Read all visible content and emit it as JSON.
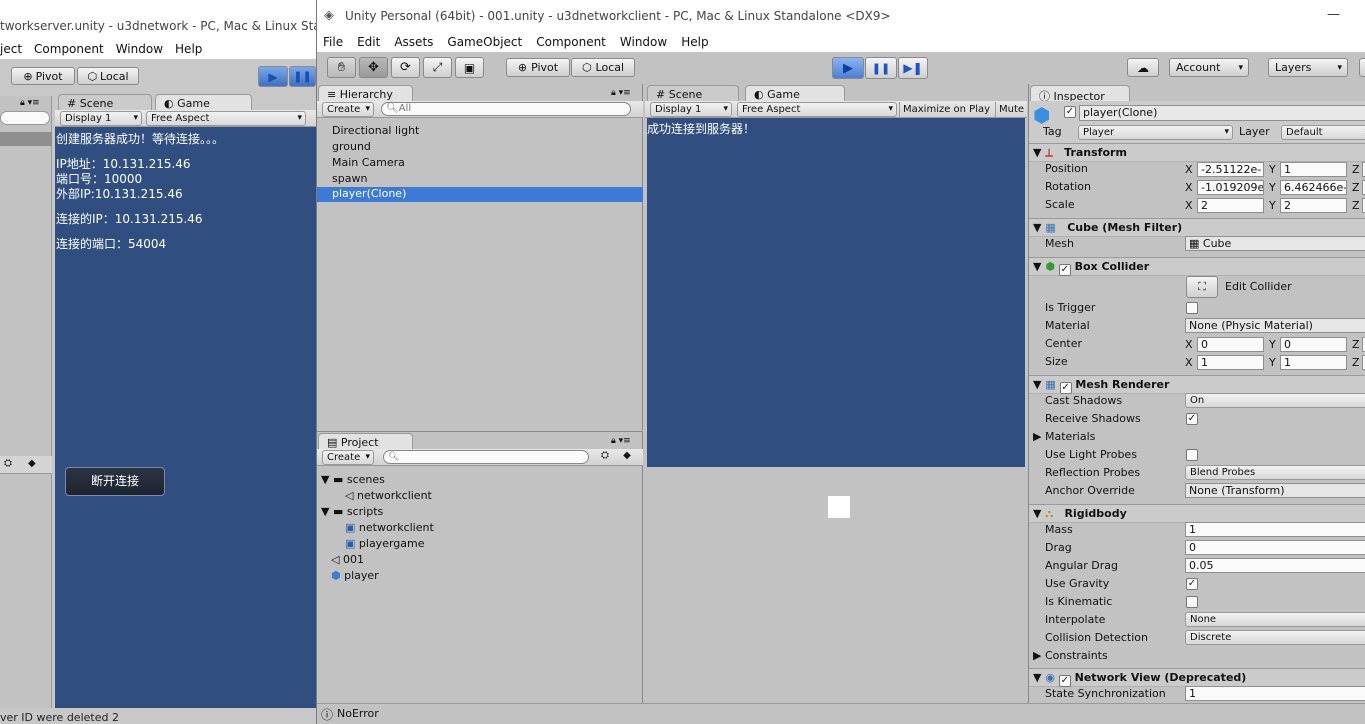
{
  "server": {
    "title": "tworkserver.unity - u3dnetwork - PC, Mac & Linux Sta",
    "menu": [
      "ject",
      "Component",
      "Window",
      "Help"
    ],
    "pivot": "Pivot",
    "local": "Local",
    "scene_tab": "Scene",
    "game_tab": "Game",
    "display": "Display 1",
    "aspect": "Free Aspect",
    "game_lines": [
      "创建服务器成功！等待连接。。。",
      "IP地址：10.131.215.46",
      "端口号：10000",
      "外部IP:10.131.215.46",
      "连接的IP：10.131.215.46",
      "连接的端口：54004"
    ],
    "disconnect_button": "断开连接",
    "console_line": "ver ID were deleted 2"
  },
  "client": {
    "title": "Unity Personal (64bit) - 001.unity - u3dnetworkclient - PC, Mac & Linux Standalone <DX9>",
    "minimize": "—",
    "menu": [
      "File",
      "Edit",
      "Assets",
      "GameObject",
      "Component",
      "Window",
      "Help"
    ],
    "toolbar": {
      "pivot": "Pivot",
      "local": "Local",
      "account": "Account",
      "layers": "Layers"
    },
    "hierarchy": {
      "tab": "Hierarchy",
      "create": "Create",
      "search_placeholder": "All",
      "items": [
        "Directional light",
        "ground",
        "Main Camera",
        "spawn",
        "player(Clone)"
      ],
      "selected_index": 4
    },
    "project": {
      "tab": "Project",
      "create": "Create",
      "tree": [
        {
          "label": "scenes",
          "kind": "folder",
          "depth": 0
        },
        {
          "label": "networkclient",
          "kind": "unity",
          "depth": 1
        },
        {
          "label": "scripts",
          "kind": "folder",
          "depth": 0
        },
        {
          "label": "networkclient",
          "kind": "script",
          "depth": 1
        },
        {
          "label": "playergame",
          "kind": "script",
          "depth": 1
        },
        {
          "label": "001",
          "kind": "unity",
          "depth": 0
        },
        {
          "label": "player",
          "kind": "prefab",
          "depth": 0
        }
      ]
    },
    "game": {
      "scene_tab": "Scene",
      "game_tab": "Game",
      "display": "Display 1",
      "aspect": "Free Aspect",
      "maximize": "Maximize on Play",
      "mute": "Mute",
      "message": "成功连接到服务器！"
    },
    "inspector": {
      "tab": "Inspector",
      "object_name": "player(Clone)",
      "tag_label": "Tag",
      "tag_value": "Player",
      "layer_label": "Layer",
      "layer_value": "Default",
      "transform": {
        "title": "Transform",
        "position_label": "Position",
        "position_x": "-2.51122e-",
        "position_y": "1",
        "rotation_label": "Rotation",
        "rotation_x": "-1.019209e",
        "rotation_y": "6.462466e-",
        "scale_label": "Scale",
        "scale_x": "2",
        "scale_y": "2"
      },
      "mesh_filter": {
        "title": "Cube (Mesh Filter)",
        "mesh_label": "Mesh",
        "mesh_value": "Cube"
      },
      "box_collider": {
        "title": "Box Collider",
        "edit": "Edit Collider",
        "is_trigger": "Is Trigger",
        "material_label": "Material",
        "material_value": "None (Physic Material)",
        "center_label": "Center",
        "center_x": "0",
        "center_y": "0",
        "size_label": "Size",
        "size_x": "1",
        "size_y": "1"
      },
      "mesh_renderer": {
        "title": "Mesh Renderer",
        "cast_shadows": "Cast Shadows",
        "cast_shadows_value": "On",
        "receive_shadows": "Receive Shadows",
        "materials": "Materials",
        "light_probes": "Use Light Probes",
        "reflection_probes": "Reflection Probes",
        "reflection_probes_value": "Blend Probes",
        "anchor_override": "Anchor Override",
        "anchor_override_value": "None (Transform)"
      },
      "rigidbody": {
        "title": "Rigidbody",
        "mass": "Mass",
        "mass_value": "1",
        "drag": "Drag",
        "drag_value": "0",
        "angular_drag": "Angular Drag",
        "angular_drag_value": "0.05",
        "use_gravity": "Use Gravity",
        "is_kinematic": "Is Kinematic",
        "interpolate": "Interpolate",
        "interpolate_value": "None",
        "collision_detection": "Collision Detection",
        "collision_detection_value": "Discrete",
        "constraints": "Constraints"
      },
      "network_view": {
        "title": "Network View (Deprecated)",
        "state_sync": "State Synchronization",
        "state_sync_value": "1"
      },
      "axis": {
        "x": "X",
        "y": "Y",
        "z": "Z"
      }
    },
    "status": "NoError"
  },
  "colors": {
    "game_bg": "#304f80",
    "selection": "#3d7ad6",
    "editor_bg": "#c2c2c2"
  }
}
